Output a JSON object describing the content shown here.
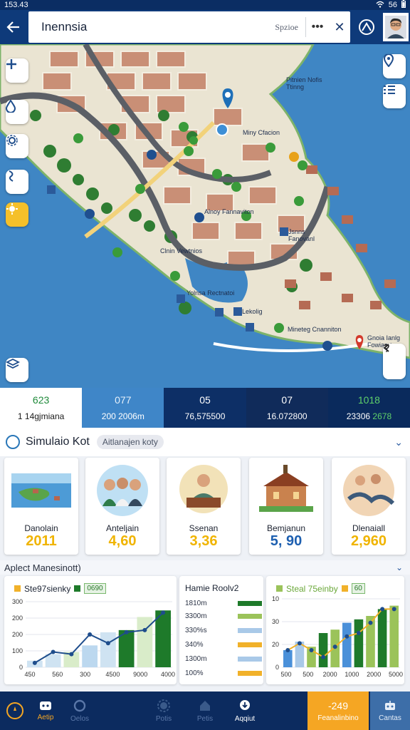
{
  "status_bar": {
    "time": "153.43",
    "signal": "56"
  },
  "search": {
    "value": "Inennsia",
    "hint": "Spzioe",
    "more": "•••",
    "close": "✕"
  },
  "map": {
    "pois": [
      {
        "label": "Pitnien Nofis"
      },
      {
        "label": "Ttinng"
      },
      {
        "label": "Miny Cfacion"
      },
      {
        "label": "Alnoy Fannaviton"
      },
      {
        "label": "Jsnns"
      },
      {
        "label": "Fanovanl"
      },
      {
        "label": "Clnin Vewtnios"
      },
      {
        "label": "Yolnsa Rectnatoi"
      },
      {
        "label": "Lekolig"
      },
      {
        "label": "Mineteg Cnanniton"
      },
      {
        "label": "Gnoia Ianlg"
      },
      {
        "label": "Fowianrt"
      }
    ]
  },
  "stats": [
    {
      "v1": "623",
      "v2": "1 14gjmiana",
      "bg": "#ffffff",
      "c1": "#1f8a3a",
      "c2": "#1a1a1a"
    },
    {
      "v1": "077",
      "v2": "200 2006m",
      "bg": "#3f86c8",
      "c1": "#e6f0fa",
      "c2": "#ffffff"
    },
    {
      "v1": "05",
      "v2": "76,575500",
      "bg": "#0d2f66",
      "c1": "#ffffff",
      "c2": "#ffffff"
    },
    {
      "v1": "07",
      "v2": "16.072800",
      "bg": "#102b5a",
      "c1": "#ffffff",
      "c2": "#ffffff"
    },
    {
      "v1": "1018",
      "v2": "23306",
      "v2b": "2678",
      "bg": "#0a2a5c",
      "c1": "#5fd06a",
      "c2": "#ffffff"
    }
  ],
  "simulation": {
    "title": "Simulaio Kot",
    "chip": "Aitlanajen koty"
  },
  "cards": [
    {
      "label": "Danolain",
      "value": "2011",
      "color": "#f0b400"
    },
    {
      "label": "Anteljain",
      "value": "4,60",
      "color": "#f0b400"
    },
    {
      "label": "Ssenan",
      "value": "3,36",
      "color": "#f0b400"
    },
    {
      "label": "Bemjanun",
      "value": "5, 90",
      "color": "#1d5fb0"
    },
    {
      "label": "Dlenaiall",
      "value": "2,960",
      "color": "#f0b400"
    }
  ],
  "analytics": {
    "title": "Aplect Manesinott)"
  },
  "chart_left": {
    "title": "Ste97sienky",
    "badge": "0690",
    "y_ticks": [
      "300",
      "200",
      "200",
      "100",
      "0"
    ],
    "x_ticks": [
      "450",
      "560",
      "300",
      "4500",
      "9000",
      "4000"
    ]
  },
  "legend": {
    "title": "Hamie Roolv2",
    "rows": [
      {
        "label": "1810m",
        "color": "#1e7a2a"
      },
      {
        "label": "3300m",
        "color": "#9bc35a"
      },
      {
        "label": "330%s",
        "color": "#a9c9e8"
      },
      {
        "label": "340%",
        "color": "#f1b12a"
      },
      {
        "label": "1300m",
        "color": "#a9c9e8"
      },
      {
        "label": "100%",
        "color": "#f1b12a"
      }
    ]
  },
  "chart_right": {
    "title": "Steal 75einby",
    "badge": "60",
    "y_ticks": [
      "10",
      "30",
      "20",
      "0"
    ],
    "x_ticks": [
      "500",
      "500",
      "2000",
      "1000",
      "2000",
      "5000"
    ]
  },
  "chart_data": [
    {
      "type": "bar",
      "title": "Ste97sienky",
      "categories": [
        "450",
        "560",
        "300",
        "4500",
        "9000",
        "4000"
      ],
      "ylim": [
        0,
        300
      ],
      "series": [
        {
          "values": [
            30,
            60,
            70,
            100,
            160,
            170,
            230,
            260
          ]
        },
        {
          "values": [
            20,
            70,
            60,
            150,
            110,
            160,
            170,
            250
          ]
        }
      ]
    },
    {
      "type": "bar",
      "title": "Steal 75einby",
      "categories": [
        "500",
        "500",
        "2000",
        "1000",
        "2000",
        "5000"
      ],
      "ylim": [
        0,
        40
      ],
      "series": [
        {
          "values": [
            10,
            15,
            12,
            20,
            22,
            26,
            28,
            30,
            34,
            36
          ]
        },
        {
          "values": [
            10,
            14,
            10,
            6,
            12,
            18,
            20,
            26,
            34,
            34
          ]
        }
      ]
    }
  ],
  "bottom_nav": {
    "items": [
      {
        "label": ""
      },
      {
        "label": "Aetip"
      },
      {
        "label": "Oelos"
      },
      {
        "label": "Potis"
      },
      {
        "label": "Petis"
      },
      {
        "label": "Aqqiut"
      }
    ],
    "cta_value": "-249",
    "cta_label": "Feanalinbino",
    "last_label": "Cantas"
  }
}
